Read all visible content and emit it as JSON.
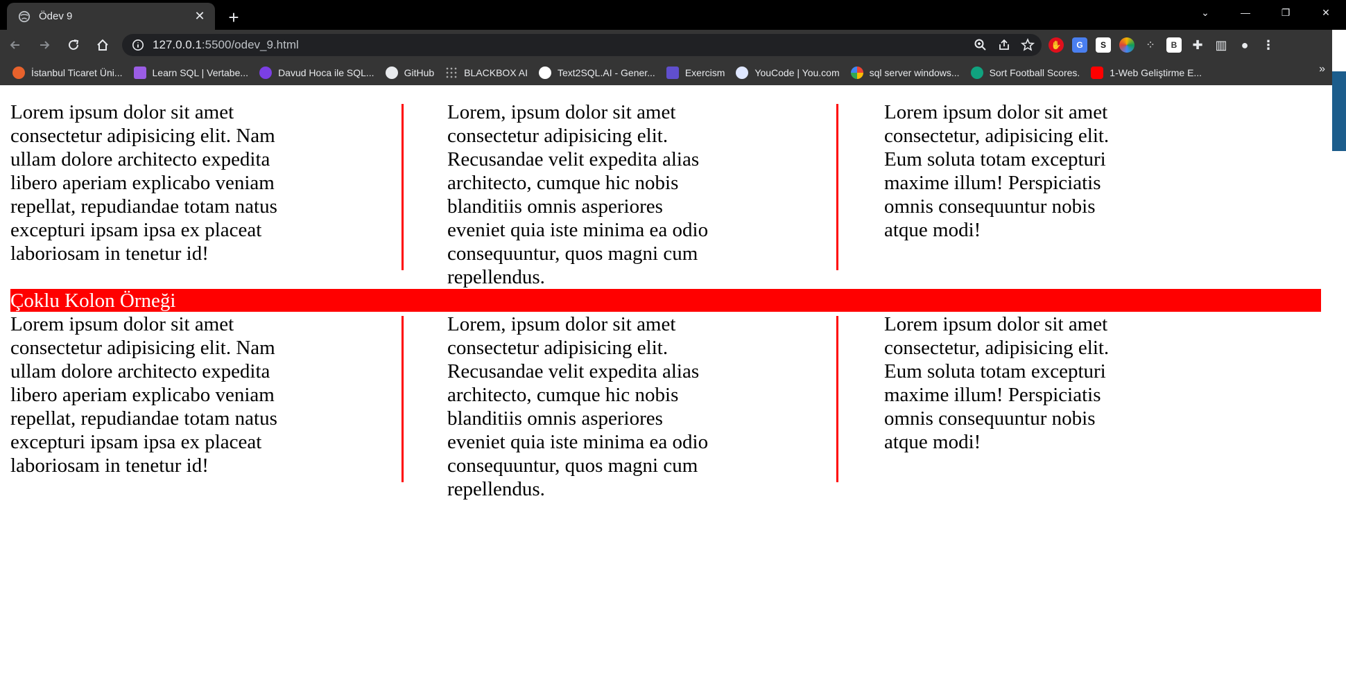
{
  "browser": {
    "tab_title": "Ödev 9",
    "url_host": "127.0.0.1",
    "url_path": ":5500/odev_9.html",
    "bookmarks": [
      {
        "label": "İstanbul Ticaret Üni...",
        "color": "#e8622c"
      },
      {
        "label": "Learn SQL | Vertabe...",
        "color": "#9b5de5"
      },
      {
        "label": "Davud Hoca ile SQL...",
        "color": "#7b3fe4"
      },
      {
        "label": "GitHub",
        "color": "#e8eaed"
      },
      {
        "label": "BLACKBOX AI",
        "color": "#888888"
      },
      {
        "label": "Text2SQL.AI - Gener...",
        "color": "#ffffff"
      },
      {
        "label": "Exercism",
        "color": "#604fcd"
      },
      {
        "label": "YouCode | You.com",
        "color": "#dfe7ff"
      },
      {
        "label": "sql server windows...",
        "color": "#4285f4"
      },
      {
        "label": "Sort Football Scores.",
        "color": "#10a37f"
      },
      {
        "label": "1-Web Geliştirme E...",
        "color": "#ff0000"
      }
    ],
    "bookmarks_overflow": "»",
    "icons": [
      "globe-icon",
      "close-icon",
      "plus-icon",
      "back-icon",
      "forward-icon",
      "reload-icon",
      "home-icon",
      "info-icon",
      "zoom-icon",
      "share-icon",
      "star-icon",
      "extensions-icon",
      "sidepanel-icon",
      "profile-icon",
      "menu-icon"
    ]
  },
  "page": {
    "heading": "Çoklu Kolon Örneği",
    "section1": {
      "col1": "Lorem ipsum dolor sit amet consectetur adipisicing elit. Nam ullam dolore architecto expedita libero aperiam explicabo veniam repellat, repudiandae totam natus excepturi ipsam ipsa ex placeat laboriosam in tenetur id!",
      "col2": "Lorem, ipsum dolor sit amet consectetur adipisicing elit. Recusandae velit expedita alias architecto, cumque hic nobis blanditiis omnis asperiores eveniet quia iste minima ea odio consequuntur, quos magni cum repellendus.",
      "col3": "Lorem ipsum dolor sit amet consectetur, adipisicing elit. Eum soluta totam excepturi maxime illum! Perspiciatis omnis consequuntur nobis atque modi!"
    },
    "section2": {
      "col1": "Lorem ipsum dolor sit amet consectetur adipisicing elit. Nam ullam dolore architecto expedita libero aperiam explicabo veniam repellat, repudiandae totam natus excepturi ipsam ipsa ex placeat laboriosam in tenetur id!",
      "col2": "Lorem, ipsum dolor sit amet consectetur adipisicing elit. Recusandae velit expedita alias architecto, cumque hic nobis blanditiis omnis asperiores eveniet quia iste minima ea odio consequuntur, quos magni cum repellendus.",
      "col3": "Lorem ipsum dolor sit amet consectetur, adipisicing elit. Eum soluta totam excepturi maxime illum! Perspiciatis omnis consequuntur nobis atque modi!"
    },
    "colors": {
      "rule": "#ff0000",
      "heading_bg": "#ff0000",
      "heading_text": "#ffffff"
    }
  }
}
